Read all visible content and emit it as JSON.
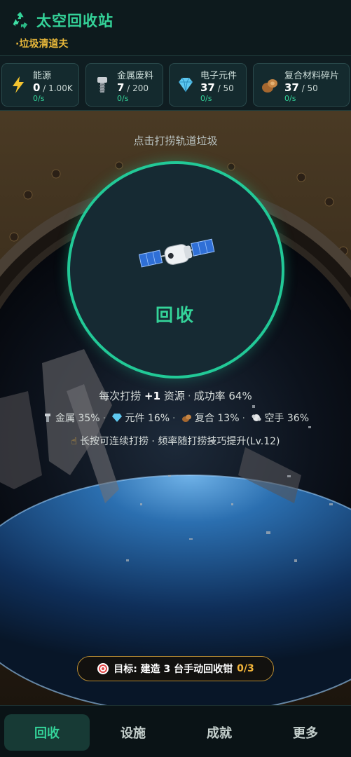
{
  "header": {
    "title": "太空回收站",
    "subtitle": "·垃圾清道夫",
    "icon": "recycle-icon"
  },
  "resources": [
    {
      "name": "能源",
      "current": "0",
      "max": " / 1.00K",
      "rate": "0/s",
      "icon": "lightning-icon"
    },
    {
      "name": "金属废料",
      "current": "7",
      "max": " / 200",
      "rate": "0/s",
      "icon": "screw-icon"
    },
    {
      "name": "电子元件",
      "current": "37",
      "max": " / 50",
      "rate": "0/s",
      "icon": "diamond-icon"
    },
    {
      "name": "复合材料碎片",
      "current": "37",
      "max": " / 50",
      "rate": "0/s",
      "icon": "wood-icon"
    }
  ],
  "main": {
    "prompt": "点击打捞轨道垃圾",
    "button_label": "回收",
    "per_click_prefix": "每次打捞 ",
    "per_click_value": "+1",
    "per_click_suffix": " 资源",
    "success_rate": "成功率 64%",
    "drops": [
      {
        "label": "金属 35%",
        "icon": "screw-icon"
      },
      {
        "label": "元件 16%",
        "icon": "diamond-icon"
      },
      {
        "label": "复合 13%",
        "icon": "wood-icon"
      },
      {
        "label": "空手 36%",
        "icon": "dust-icon"
      }
    ],
    "hint": "长按可连续打捞 · 频率随打捞技巧提升(Lv.12)",
    "goal_label": "目标: 建造 3 台手动回收钳 ",
    "goal_progress": "0/3"
  },
  "nav": {
    "tabs": [
      "回收",
      "设施",
      "成就",
      "更多"
    ],
    "active": 0
  },
  "colors": {
    "accent": "#34d399",
    "gold": "#e7b73a",
    "goal_border": "#b58a33"
  }
}
